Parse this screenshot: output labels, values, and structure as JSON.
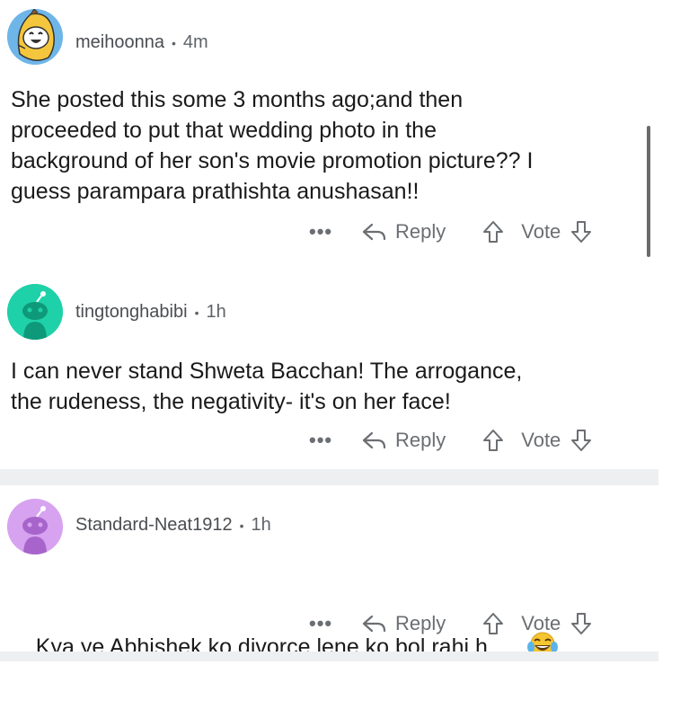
{
  "comments": [
    {
      "username": "meihoonna",
      "time": "4m",
      "text": "She posted this some 3 months ago;and then\nproceeded to put that wedding photo in the\nbackground of her son's movie promotion picture?? I\nguess parampara prathishta anushasan!!",
      "avatar": "snoo-banana-avatar",
      "actions": {
        "more": "•••",
        "reply": "Reply",
        "vote": "Vote"
      }
    },
    {
      "username": "tingtonghabibi",
      "time": "1h",
      "text": "I can never stand Shweta Bacchan! The arrogance,\nthe rudeness, the negativity- it's on her face!",
      "avatar": "snoo-default-teal-avatar",
      "actions": {
        "more": "•••",
        "reply": "Reply",
        "vote": "Vote"
      }
    },
    {
      "username": "Standard-Neat1912",
      "time": "1h",
      "text": "Kya ye Abhishek ko divorce lene ko bol rahi h",
      "emoji": "laughing-crying-emoji",
      "avatar": "snoo-default-purple-avatar",
      "actions": {
        "more": "•••",
        "reply": "Reply",
        "vote": "Vote"
      }
    }
  ],
  "colors": {
    "teal_avatar": "#1fd1a8",
    "purple_avatar": "#d7a3f0",
    "banana_avatar_bg": "#6fb6e8",
    "separator": "#eeeff1"
  }
}
